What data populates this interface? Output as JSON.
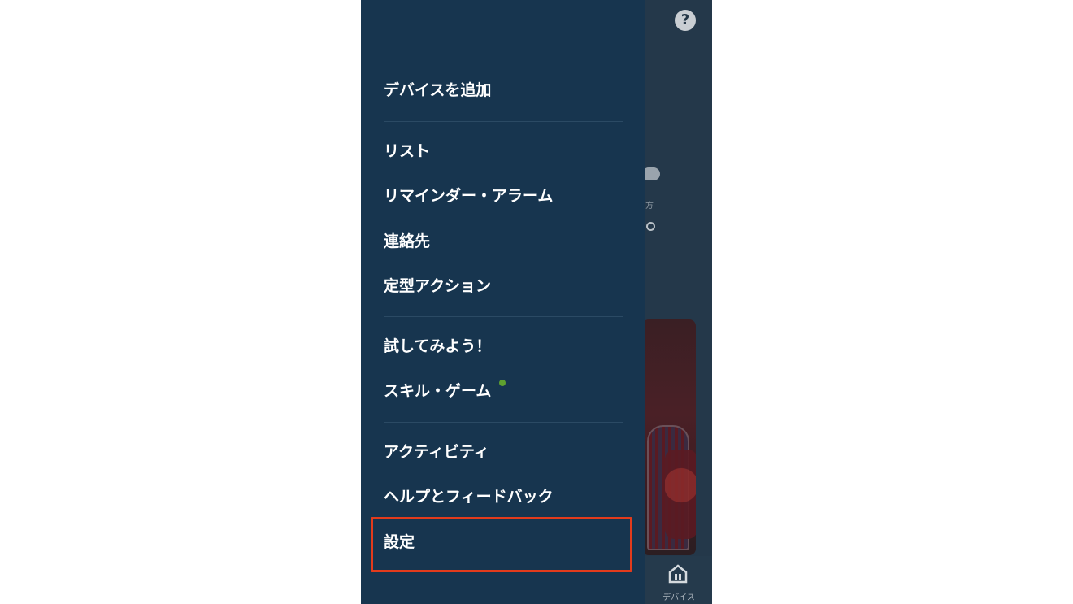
{
  "background": {
    "help_icon": "question-mark-icon",
    "help_label": "?",
    "weather_small_text": "方",
    "bottom_nav": {
      "label": "デバイス",
      "icon": "home-devices-icon"
    }
  },
  "drawer": {
    "items": [
      {
        "label": "デバイスを追加"
      },
      {
        "label": "リスト"
      },
      {
        "label": "リマインダー・アラーム"
      },
      {
        "label": "連絡先"
      },
      {
        "label": "定型アクション"
      },
      {
        "label": "試してみよう！"
      },
      {
        "label": "スキル・ゲーム",
        "has_badge": true
      },
      {
        "label": "アクティビティ"
      },
      {
        "label": "ヘルプとフィードバック"
      },
      {
        "label": "設定",
        "highlighted": true
      }
    ]
  },
  "colors": {
    "drawer_bg": "#17354f",
    "badge": "#5fa12f",
    "highlight_border": "#e33b1c"
  }
}
